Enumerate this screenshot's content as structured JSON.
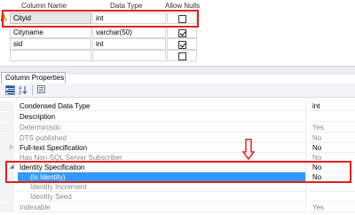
{
  "grid": {
    "headers": [
      "Column Name",
      "Data Type",
      "Allow Nulls"
    ],
    "rows": [
      {
        "name": "Cityid",
        "type": "int",
        "allow_nulls": false,
        "primary_key": true
      },
      {
        "name": "Cityname",
        "type": "varchar(50)",
        "allow_nulls": true,
        "primary_key": false
      },
      {
        "name": "sid",
        "type": "int",
        "allow_nulls": true,
        "primary_key": false
      },
      {
        "name": "",
        "type": "",
        "allow_nulls": false,
        "primary_key": false
      }
    ]
  },
  "properties_pane": {
    "tab_label": "Column Properties",
    "toolbar": {
      "categorized_icon": "categorized-icon",
      "alphabetical_icon": "alphabetical-icon",
      "property_pages_icon": "property-pages-icon"
    },
    "rows": [
      {
        "name": "Condensed Data Type",
        "value": "int"
      },
      {
        "name": "Description",
        "value": ""
      },
      {
        "name": "Deterministic",
        "value": "Yes"
      },
      {
        "name": "DTS-published",
        "value": "No"
      },
      {
        "name": "Full-text Specification",
        "value": "No"
      },
      {
        "name": "Has Non-SQL Server Subscriber",
        "value": "No"
      },
      {
        "name": "Identity Specification",
        "value": "No"
      },
      {
        "name": "(Is Identity)",
        "value": "No"
      },
      {
        "name": "Identity Increment",
        "value": ""
      },
      {
        "name": "Identity Seed",
        "value": ""
      },
      {
        "name": "Indexable",
        "value": "Yes"
      }
    ]
  },
  "colors": {
    "highlight_border": "#e02020",
    "selection": "#3399ff"
  }
}
